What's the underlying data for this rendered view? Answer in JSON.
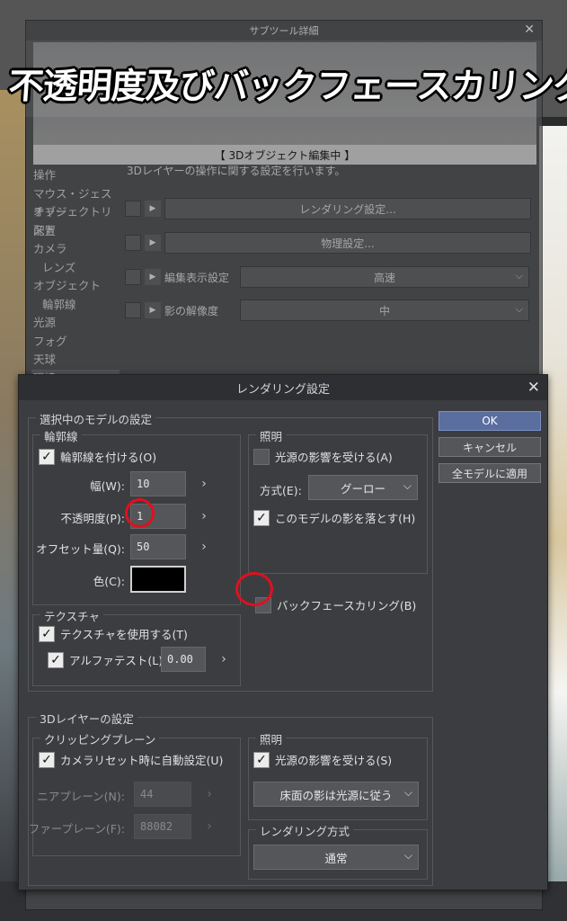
{
  "banner": {
    "text": "不透明度及びバックフェースカリング"
  },
  "sub_tool_window": {
    "title": "サブツール詳細",
    "preview_label": "【 3Dオブジェクト編集中 】",
    "description": "3Dレイヤーの操作に関する設定を行います。",
    "categories": [
      {
        "label": "操作",
        "indent": false,
        "selected": false
      },
      {
        "label": "マウス・ジェスチャー",
        "indent": false,
        "selected": false
      },
      {
        "label": "オブジェクトリスト",
        "indent": false,
        "selected": false
      },
      {
        "label": "配置",
        "indent": false,
        "selected": false
      },
      {
        "label": "カメラ",
        "indent": false,
        "selected": false
      },
      {
        "label": "レンズ",
        "indent": true,
        "selected": false
      },
      {
        "label": "オブジェクト",
        "indent": false,
        "selected": false
      },
      {
        "label": "輪郭線",
        "indent": true,
        "selected": false
      },
      {
        "label": "光源",
        "indent": false,
        "selected": false
      },
      {
        "label": "フォグ",
        "indent": false,
        "selected": false
      },
      {
        "label": "天球",
        "indent": false,
        "selected": false
      },
      {
        "label": "環境",
        "indent": false,
        "selected": true
      }
    ],
    "rendering_button": "レンダリング設定...",
    "physics_button": "物理設定...",
    "edit_display_label": "編集表示設定",
    "edit_display_value": "高速",
    "shadow_resolution_label": "影の解像度",
    "shadow_resolution_value": "中"
  },
  "dialog": {
    "title": "レンダリング設定",
    "buttons": {
      "ok": "OK",
      "cancel": "キャンセル",
      "apply_all": "全モデルに適用"
    },
    "model_settings": {
      "legend": "選択中のモデルの設定",
      "outline": {
        "legend": "輪郭線",
        "enable_label": "輪郭線を付ける(O)",
        "enable_checked": true,
        "width_label": "幅(W):",
        "width_value": "10",
        "opacity_label": "不透明度(P):",
        "opacity_value": "1",
        "offset_label": "オフセット量(Q):",
        "offset_value": "50",
        "color_label": "色(C):",
        "color_value": "#000000"
      },
      "lighting": {
        "legend": "照明",
        "receive_label": "光源の影響を受ける(A)",
        "receive_checked": false,
        "method_label": "方式(E):",
        "method_value": "グーロー",
        "cast_shadow_label": "このモデルの影を落とす(H)",
        "cast_shadow_checked": true
      },
      "backface_label": "バックフェースカリング(B)",
      "backface_checked": false,
      "texture": {
        "legend": "テクスチャ",
        "use_label": "テクスチャを使用する(T)",
        "use_checked": true,
        "alpha_label": "アルファテスト(L)",
        "alpha_checked": true,
        "alpha_value": "0.00"
      }
    },
    "layer_settings": {
      "legend": "3Dレイヤーの設定",
      "clipping": {
        "legend": "クリッピングプレーン",
        "auto_label": "カメラリセット時に自動設定(U)",
        "auto_checked": true,
        "near_label": "ニアプレーン(N):",
        "near_value": "44",
        "far_label": "ファープレーン(F):",
        "far_value": "88082"
      },
      "lighting": {
        "legend": "照明",
        "receive_label": "光源の影響を受ける(S)",
        "receive_checked": true,
        "floor_shadow_value": "床面の影は光源に従う"
      },
      "rendering_method": {
        "legend": "レンダリング方式",
        "value": "通常"
      }
    }
  },
  "highlight_color": "#e0101e"
}
